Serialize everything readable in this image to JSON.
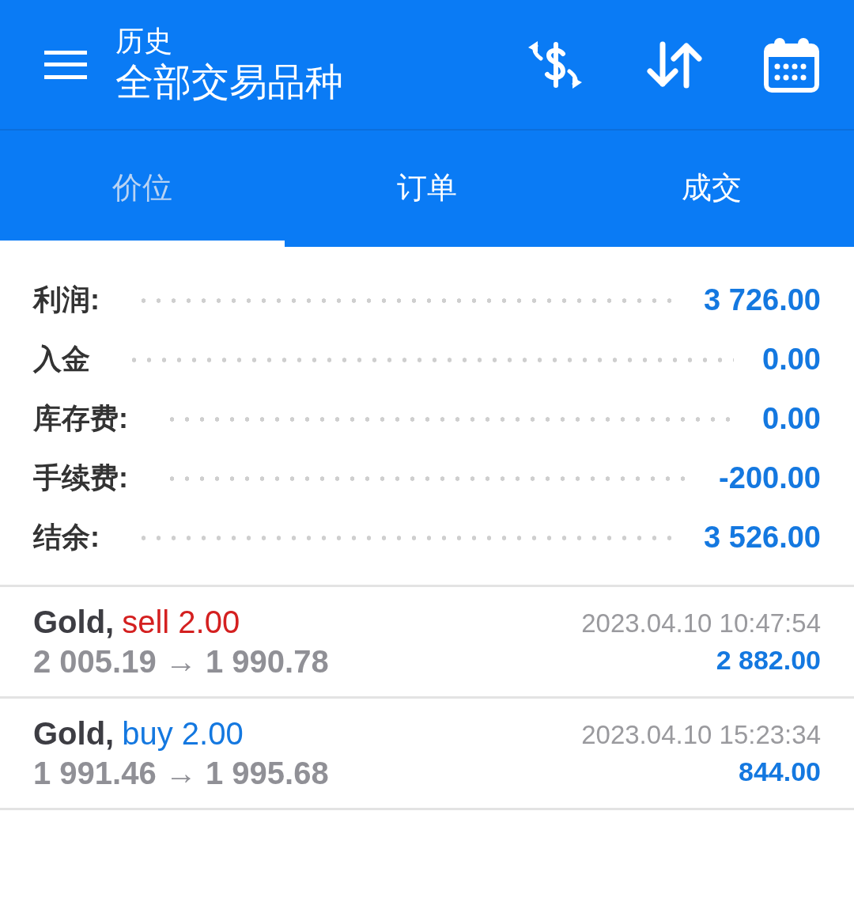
{
  "header": {
    "subtitle": "历史",
    "title": "全部交易品种"
  },
  "tabs": [
    {
      "label": "价位",
      "selected": true
    },
    {
      "label": "订单",
      "selected": false
    },
    {
      "label": "成交",
      "selected": false
    }
  ],
  "summary": [
    {
      "label": "利润:",
      "value": "3 726.00"
    },
    {
      "label": "入金",
      "value": "0.00"
    },
    {
      "label": "库存费:",
      "value": "0.00"
    },
    {
      "label": "手续费:",
      "value": "-200.00"
    },
    {
      "label": "结余:",
      "value": "3 526.00"
    }
  ],
  "trades": [
    {
      "symbol": "Gold,",
      "kind": "sell",
      "type": "sell 2.00",
      "prices": "2 005.19 → 1 990.78",
      "time": "2023.04.10 10:47:54",
      "profit": "2 882.00"
    },
    {
      "symbol": "Gold,",
      "kind": "buy",
      "type": "buy 2.00",
      "prices": "1 991.46 → 1 995.68",
      "time": "2023.04.10 15:23:34",
      "profit": "844.00"
    }
  ]
}
